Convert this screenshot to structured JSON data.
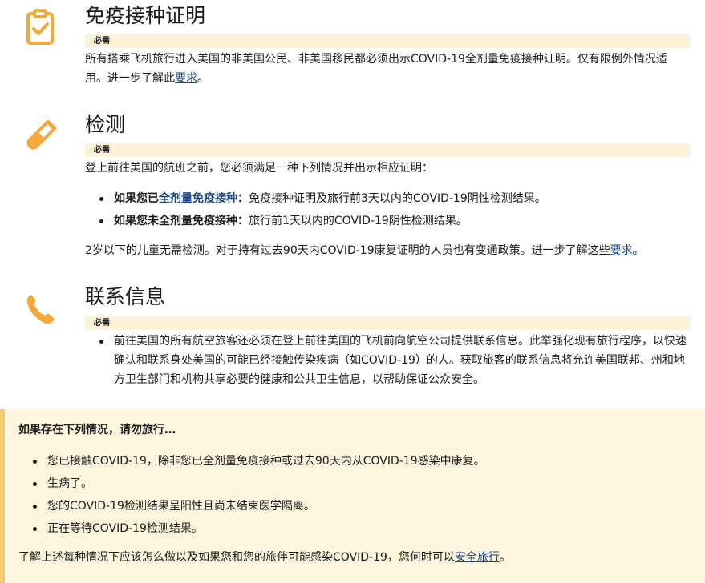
{
  "vaccination": {
    "icon": "clipboard-check-icon",
    "title": "免疫接种证明",
    "badge": "必需",
    "text_before": "所有搭乘飞机旅行进入美国的非美国公民、非美国移民都必须出示COVID-19全剂量免疫接种证明。仅有限例外情况适用。进一步了解此",
    "link": "要求",
    "text_after": "。"
  },
  "testing": {
    "icon": "test-tube-icon",
    "title": "检测",
    "badge": "必需",
    "intro": "登上前往美国的航班之前，您必须满足一种下列情况并出示相应证明：",
    "items": [
      {
        "bold_before": "如果您已",
        "bold_link": "全剂量免疫接种",
        "bold_after": "：",
        "text": "免疫接种证明及旅行前3天以内的COVID-19阴性检测结果。"
      },
      {
        "bold": "如果您未全剂量免疫接种：",
        "text": "旅行前1天以内的COVID-19阴性检测结果。"
      }
    ],
    "note_before": "2岁以下的儿童无需检测。对于持有过去90天内COVID-19康复证明的人员也有变通政策。进一步了解这些",
    "note_link": "要求",
    "note_after": "。"
  },
  "contact": {
    "icon": "phone-icon",
    "title": "联系信息",
    "badge": "必需",
    "item": "前往美国的所有航空旅客还必须在登上前往美国的飞机前向航空公司提供联系信息。此举强化现有旅行程序，以快速确认和联系身处美国的可能已经接触传染疾病（如COVID-19）的人。获取旅客的联系信息将允许美国联邦、州和地方卫生部门和机构共享必要的健康和公共卫生信息，以帮助保证公众安全。"
  },
  "warning": {
    "title": "如果存在下列情况，请勿旅行…",
    "items": [
      "您已接触COVID-19，除非您已全剂量免疫接种或过去90天内从COVID-19感染中康复。",
      "生病了。",
      "您的COVID-19检测结果呈阳性且尚未结束医学隔离。",
      "正在等待COVID-19检测结果。"
    ],
    "foot_before": "了解上述每种情况下应该怎么做以及如果您和您的旅伴可能感染COVID-19，您何时可以",
    "foot_link": "安全旅行",
    "foot_after": "。"
  },
  "colors": {
    "accent_orange": "#f2a93b",
    "badge_bg": "#fdf1d6",
    "warning_bg": "#fef5df",
    "warning_border": "#f6c86f",
    "link": "#1a4480"
  }
}
